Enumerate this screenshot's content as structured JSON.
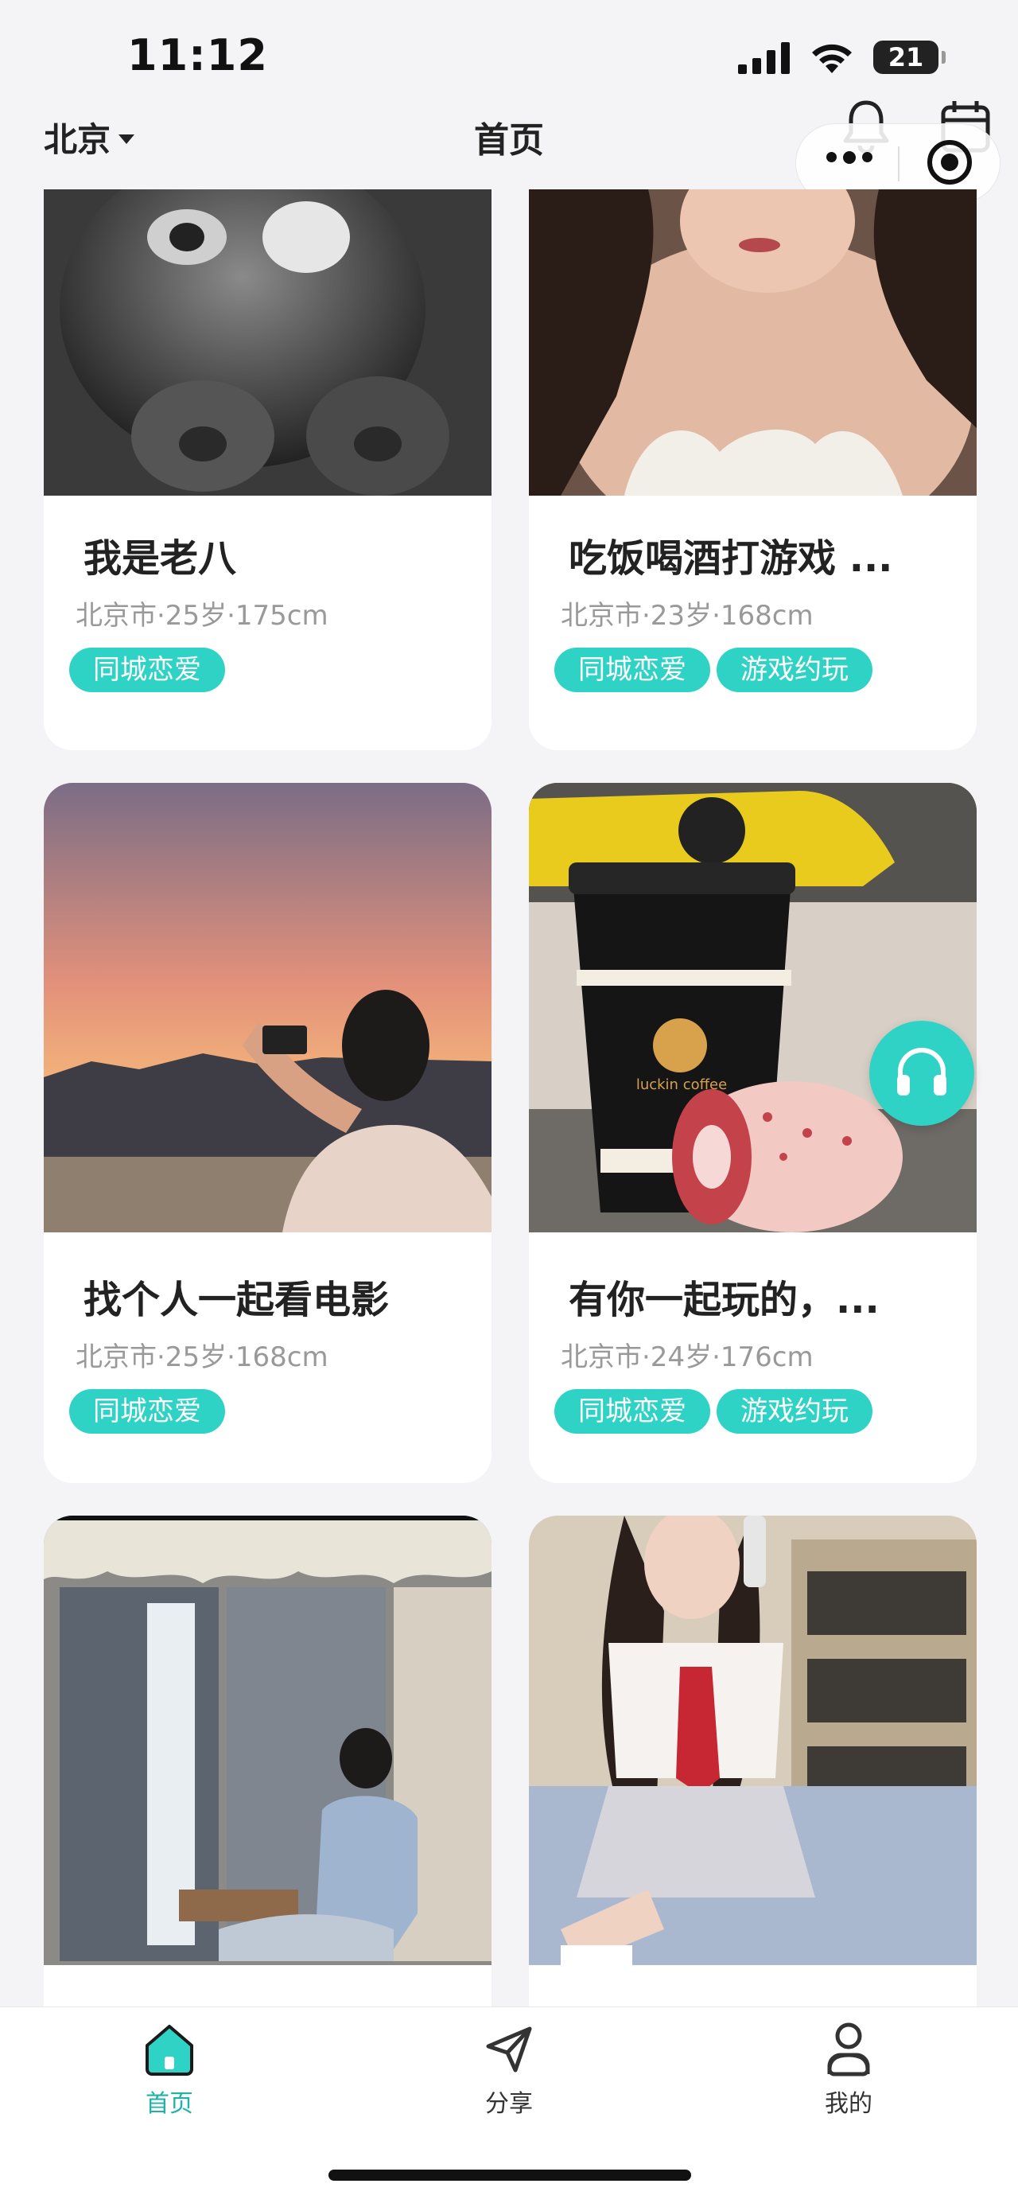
{
  "status_bar": {
    "time": "11:12",
    "battery": "21"
  },
  "nav": {
    "city": "北京",
    "title": "首页"
  },
  "cards": [
    {
      "title": "我是老八",
      "meta": "北京市·25岁·175cm",
      "tags": [
        "同城恋爱"
      ]
    },
    {
      "title": "吃饭喝酒打游戏 ...",
      "meta": "北京市·23岁·168cm",
      "tags": [
        "同城恋爱",
        "游戏约玩"
      ]
    },
    {
      "title": "找个人一起看电影",
      "meta": "北京市·25岁·168cm",
      "tags": [
        "同城恋爱"
      ]
    },
    {
      "title": "有你一起玩的，...",
      "meta": "北京市·24岁·176cm",
      "tags": [
        "同城恋爱",
        "游戏约玩"
      ]
    },
    {
      "title": "",
      "meta": "",
      "tags": []
    },
    {
      "title": "",
      "meta": "",
      "tags": []
    }
  ],
  "photo_labels": {
    "coffee_brand": "luckin coffee"
  },
  "tab_bar": {
    "home": "首页",
    "share": "分享",
    "mine": "我的"
  },
  "colors": {
    "accent": "#2fd3c6",
    "accent_text": "#1fb3a8",
    "background": "#f4f4f6"
  },
  "icons": [
    "bell-icon",
    "calendar-icon",
    "more-icon",
    "close-icon",
    "headset-icon",
    "home-icon",
    "share-icon",
    "profile-icon"
  ]
}
